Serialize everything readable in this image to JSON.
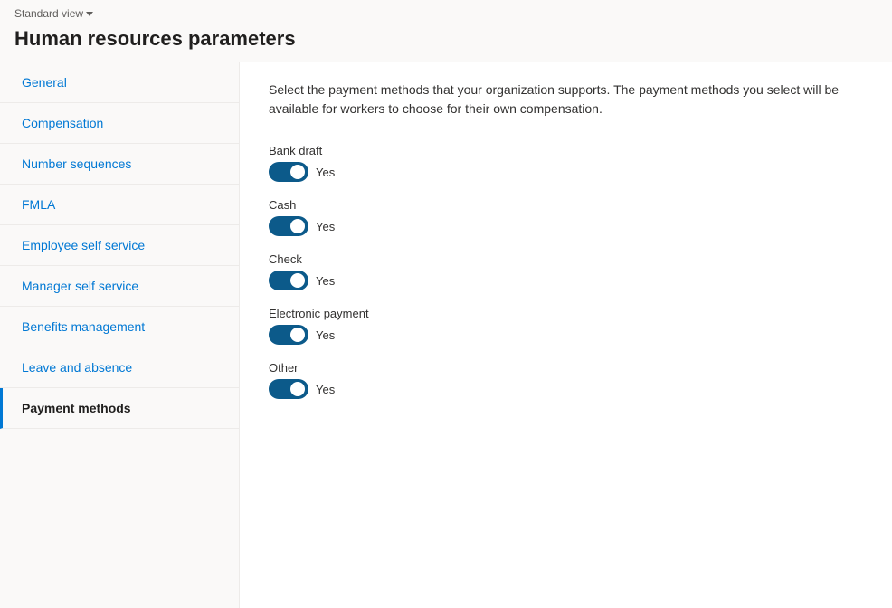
{
  "top": {
    "standard_view_label": "Standard view",
    "chevron": "chevron-down"
  },
  "page": {
    "title": "Human resources parameters"
  },
  "sidebar": {
    "items": [
      {
        "id": "general",
        "label": "General",
        "active": false
      },
      {
        "id": "compensation",
        "label": "Compensation",
        "active": false
      },
      {
        "id": "number-sequences",
        "label": "Number sequences",
        "active": false
      },
      {
        "id": "fmla",
        "label": "FMLA",
        "active": false
      },
      {
        "id": "employee-self-service",
        "label": "Employee self service",
        "active": false
      },
      {
        "id": "manager-self-service",
        "label": "Manager self service",
        "active": false
      },
      {
        "id": "benefits-management",
        "label": "Benefits management",
        "active": false
      },
      {
        "id": "leave-and-absence",
        "label": "Leave and absence",
        "active": false
      },
      {
        "id": "payment-methods",
        "label": "Payment methods",
        "active": true
      }
    ]
  },
  "content": {
    "description": "Select the payment methods that your organization supports. The payment methods you select will be available for workers to choose for their own compensation.",
    "payment_methods": [
      {
        "id": "bank-draft",
        "label": "Bank draft",
        "enabled": true,
        "yes_label": "Yes"
      },
      {
        "id": "cash",
        "label": "Cash",
        "enabled": true,
        "yes_label": "Yes"
      },
      {
        "id": "check",
        "label": "Check",
        "enabled": true,
        "yes_label": "Yes"
      },
      {
        "id": "electronic-payment",
        "label": "Electronic payment",
        "enabled": true,
        "yes_label": "Yes"
      },
      {
        "id": "other",
        "label": "Other",
        "enabled": true,
        "yes_label": "Yes"
      }
    ]
  }
}
